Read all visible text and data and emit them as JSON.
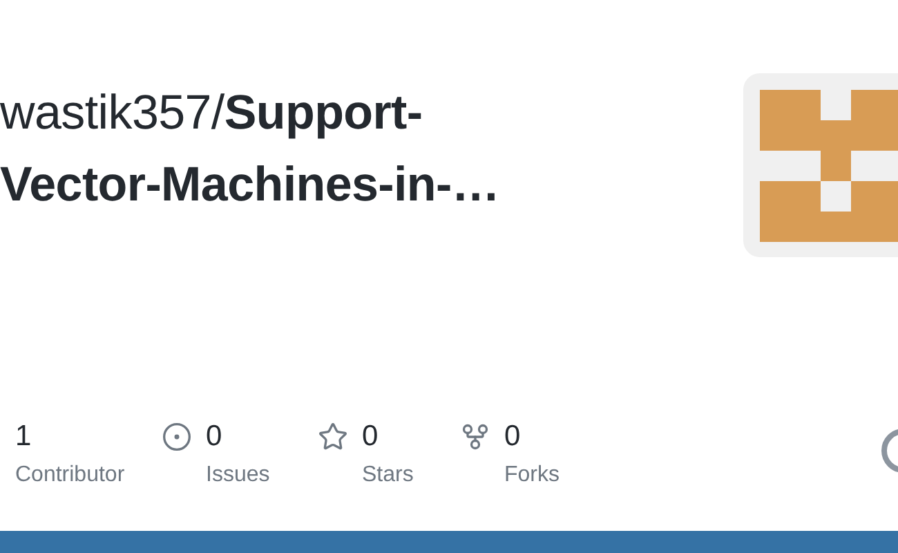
{
  "repo": {
    "owner": "wastik357/",
    "name_line_1": "Support-",
    "name_line_2": "Vector-Machines-in-…"
  },
  "stats": [
    {
      "kind": "contributors",
      "value": "1",
      "label": "Contributor"
    },
    {
      "kind": "issues",
      "value": "0",
      "label": "Issues"
    },
    {
      "kind": "stars",
      "value": "0",
      "label": "Stars"
    },
    {
      "kind": "forks",
      "value": "0",
      "label": "Forks"
    }
  ]
}
